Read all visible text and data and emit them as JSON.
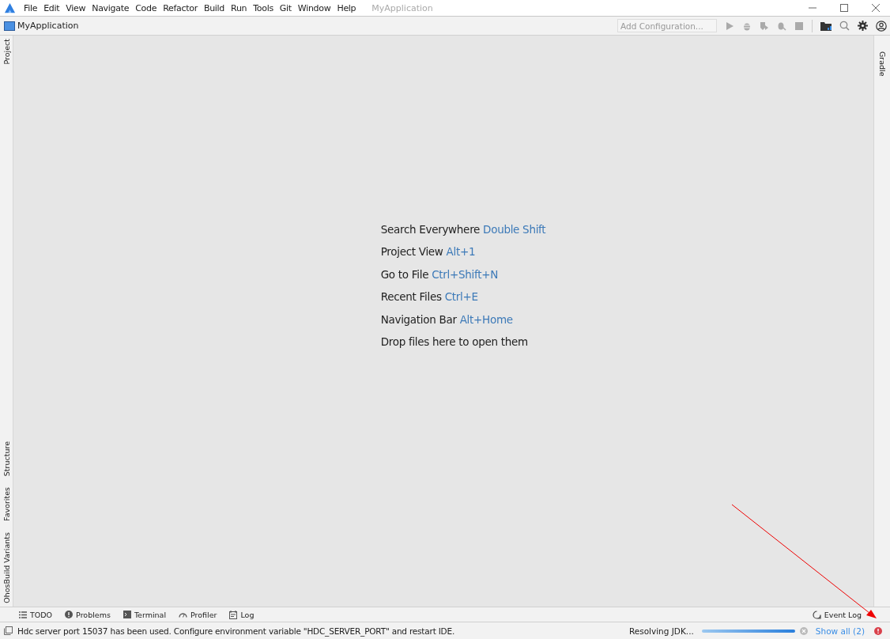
{
  "menu": [
    "File",
    "Edit",
    "View",
    "Navigate",
    "Code",
    "Refactor",
    "Build",
    "Run",
    "Tools",
    "Git",
    "Window",
    "Help"
  ],
  "window": {
    "title": "MyApplication"
  },
  "nav_bar": {
    "project": "MyApplication",
    "run_config": {
      "placeholder": "Add Configuration..."
    }
  },
  "left_tool_windows": {
    "top": [
      {
        "label": "Project"
      }
    ],
    "bottom": [
      {
        "label": "Structure"
      },
      {
        "label": "Favorites"
      },
      {
        "label": "OhosBuild Variants"
      }
    ]
  },
  "right_tool_windows": [
    {
      "label": "Gradle"
    }
  ],
  "editor_hints": [
    {
      "action": "Search Everywhere",
      "shortcut": "Double Shift"
    },
    {
      "action": "Project View",
      "shortcut": "Alt+1"
    },
    {
      "action": "Go to File",
      "shortcut": "Ctrl+Shift+N"
    },
    {
      "action": "Recent Files",
      "shortcut": "Ctrl+E"
    },
    {
      "action": "Navigation Bar",
      "shortcut": "Alt+Home"
    },
    {
      "action": "Drop files here to open them"
    }
  ],
  "bottom_tabs": [
    {
      "label": "TODO",
      "kind": "list"
    },
    {
      "label": "Problems",
      "kind": "problems"
    },
    {
      "label": "Terminal",
      "kind": "terminal"
    },
    {
      "label": "Profiler",
      "kind": "profiler"
    },
    {
      "label": "Log",
      "kind": "log"
    }
  ],
  "event_log": "Event Log",
  "status_bar": {
    "message": "Hdc server port 15037 has been used. Configure environment variable \"HDC_SERVER_PORT\" and restart IDE.",
    "task": "Resolving JDK...",
    "progress": {
      "level": 1
    },
    "show_all": "Show all (2)"
  }
}
